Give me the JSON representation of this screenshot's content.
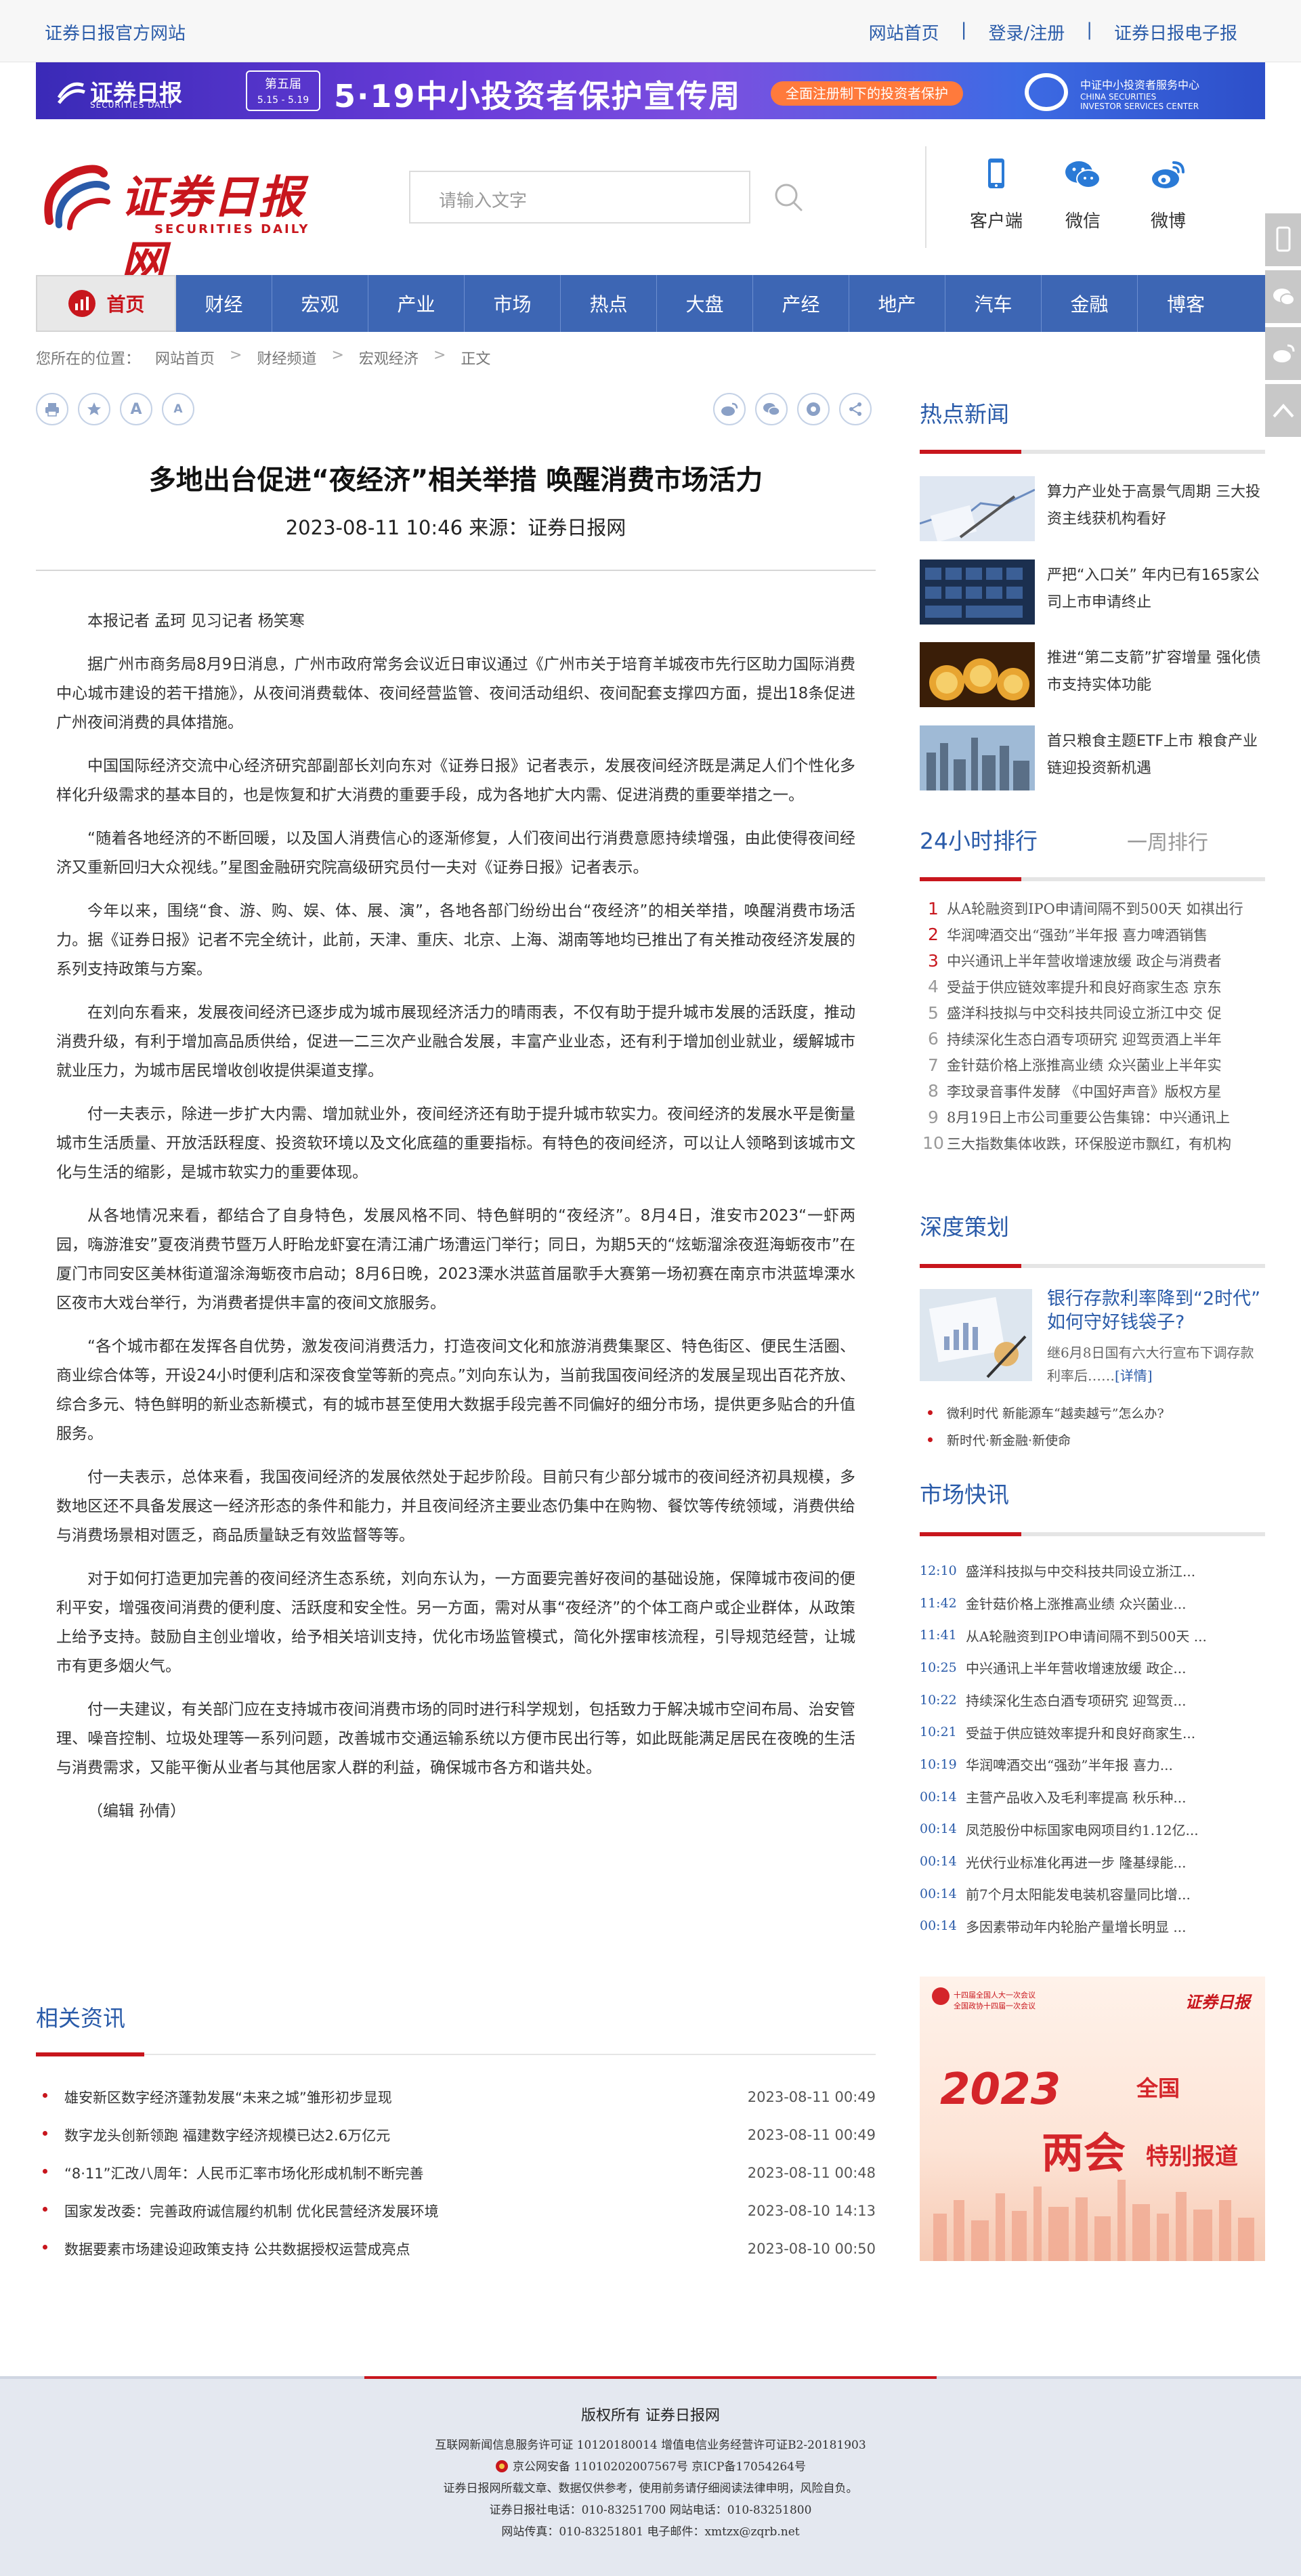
{
  "topbar": {
    "site_name": "证券日报官方网站",
    "links": [
      "网站首页",
      "登录/注册",
      "证券日报电子报"
    ],
    "sep": "|"
  },
  "banner": {
    "logo": "证券日报",
    "logo_sub": "SECURITIES DAILY",
    "badge_line1": "第五届",
    "badge_line2": "5.15 - 5.19",
    "title": "5·19中小投资者保护宣传周",
    "pill": "全面注册制下的投资者保护",
    "org_cn": "中证中小投资者服务中心",
    "org_en1": "CHINA SECURITIES",
    "org_en2": "INVESTOR SERVICES CENTER"
  },
  "header": {
    "logo_text": "证券日报网",
    "logo_en": "SECURITIES DAILY",
    "search_placeholder": "请输入文字",
    "icons": [
      {
        "label": "客户端",
        "icon": "phone-icon"
      },
      {
        "label": "微信",
        "icon": "wechat-icon"
      },
      {
        "label": "微博",
        "icon": "weibo-icon"
      }
    ]
  },
  "nav": {
    "home": "首页",
    "items": [
      "财经",
      "宏观",
      "产业",
      "市场",
      "热点",
      "大盘",
      "产经",
      "地产",
      "汽车",
      "金融",
      "博客"
    ]
  },
  "breadcrumb": {
    "label": "您所在的位置：",
    "items": [
      "网站首页",
      "财经频道",
      "宏观经济",
      "正文"
    ]
  },
  "article": {
    "tools_left": [
      "print-icon",
      "favorite-icon",
      "font-increase-icon",
      "font-decrease-icon"
    ],
    "font_big": "A",
    "font_small": "A",
    "tools_right": [
      "weibo-share-icon",
      "wechat-share-icon",
      "qzone-share-icon",
      "more-share-icon"
    ],
    "title": "多地出台促进“夜经济”相关举措 唤醒消费市场活力",
    "meta": "2023-08-11 10:46  来源：证券日报网",
    "paragraphs": [
      "本报记者 孟珂 见习记者 杨笑寒",
      "据广州市商务局8月9日消息，广州市政府常务会议近日审议通过《广州市关于培育羊城夜市先行区助力国际消费中心城市建设的若干措施》，从夜间消费载体、夜间经营监管、夜间活动组织、夜间配套支撑四方面，提出18条促进广州夜间消费的具体措施。",
      "中国国际经济交流中心经济研究部副部长刘向东对《证券日报》记者表示，发展夜间经济既是满足人们个性化多样化升级需求的基本目的，也是恢复和扩大消费的重要手段，成为各地扩大内需、促进消费的重要举措之一。",
      "“随着各地经济的不断回暖，以及国人消费信心的逐渐修复，人们夜间出行消费意愿持续增强，由此使得夜间经济又重新回归大众视线。”星图金融研究院高级研究员付一夫对《证券日报》记者表示。",
      "今年以来，围绕“食、游、购、娱、体、展、演”，各地各部门纷纷出台“夜经济”的相关举措，唤醒消费市场活力。据《证券日报》记者不完全统计，此前，天津、重庆、北京、上海、湖南等地均已推出了有关推动夜经济发展的系列支持政策与方案。",
      "在刘向东看来，发展夜间经济已逐步成为城市展现经济活力的晴雨表，不仅有助于提升城市发展的活跃度，推动消费升级，有利于增加高品质供给，促进一二三次产业融合发展，丰富产业业态，还有利于增加创业就业，缓解城市就业压力，为城市居民增收创收提供渠道支撑。",
      "付一夫表示，除进一步扩大内需、增加就业外，夜间经济还有助于提升城市软实力。夜间经济的发展水平是衡量城市生活质量、开放活跃程度、投资软环境以及文化底蕴的重要指标。有特色的夜间经济，可以让人领略到该城市文化与生活的缩影，是城市软实力的重要体现。",
      "从各地情况来看，都结合了自身特色，发展风格不同、特色鲜明的“夜经济”。8月4日，淮安市2023“一虾两园，嗨游淮安”夏夜消费节暨万人盱眙龙虾宴在清江浦广场漕运门举行；同日，为期5天的“炫蛎溜涂夜逛海蛎夜市”在厦门市同安区美林街道溜涂海蛎夜市启动；8月6日晚，2023溧水洪蓝首届歌手大赛第一场初赛在南京市洪蓝埠溧水区夜市大戏台举行，为消费者提供丰富的夜间文旅服务。",
      "“各个城市都在发挥各自优势，激发夜间消费活力，打造夜间文化和旅游消费集聚区、特色街区、便民生活圈、商业综合体等，开设24小时便利店和深夜食堂等新的亮点。”刘向东认为，当前我国夜间经济的发展呈现出百花齐放、综合多元、特色鲜明的新业态新模式，有的城市甚至使用大数据手段完善不同偏好的细分市场，提供更多贴合的升值服务。",
      "付一夫表示，总体来看，我国夜间经济的发展依然处于起步阶段。目前只有少部分城市的夜间经济初具规模，多数地区还不具备发展这一经济形态的条件和能力，并且夜间经济主要业态仍集中在购物、餐饮等传统领域，消费供给与消费场景相对匮乏，商品质量缺乏有效监督等等。",
      "对于如何打造更加完善的夜间经济生态系统，刘向东认为，一方面要完善好夜间的基础设施，保障城市夜间的便利平安，增强夜间消费的便利度、活跃度和安全性。另一方面，需对从事“夜经济”的个体工商户或企业群体，从政策上给予支持。鼓励自主创业增收，给予相关培训支持，优化市场监管模式，简化外摆审核流程，引导规范经营，让城市有更多烟火气。",
      "付一夫建议，有关部门应在支持城市夜间消费市场的同时进行科学规划，包括致力于解决城市空间布局、治安管理、噪音控制、垃圾处理等一系列问题，改善城市交通运输系统以方便市民出行等，如此既能满足居民在夜晚的生活与消费需求，又能平衡从业者与其他居家人群的利益，确保城市各方和谐共处。",
      "（编辑 孙倩）"
    ]
  },
  "related": {
    "title": "相关资讯",
    "items": [
      {
        "title": "雄安新区数字经济蓬勃发展“未来之城”雏形初步显现",
        "date": "2023-08-11 00:49"
      },
      {
        "title": "数字龙头创新领跑 福建数字经济规模已达2.6万亿元",
        "date": "2023-08-11 00:49"
      },
      {
        "title": "“8·11”汇改八周年：人民币汇率市场化形成机制不断完善",
        "date": "2023-08-11 00:48"
      },
      {
        "title": "国家发改委：完善政府诚信履约机制 优化民营经济发展环境",
        "date": "2023-08-10 14:13"
      },
      {
        "title": "数据要素市场建设迎政策支持 公共数据授权运营成亮点",
        "date": "2023-08-10 00:50"
      }
    ]
  },
  "sidebar": {
    "hot_title": "热点新闻",
    "hot": [
      {
        "title": "算力产业处于高景气周期 三大投资主线获机构看好"
      },
      {
        "title": "严把“入口关” 年内已有165家公司上市申请终止"
      },
      {
        "title": "推进“第二支箭”扩容增量 强化债市支持实体功能"
      },
      {
        "title": "首只粮食主题ETF上市 粮食产业链迎投资新机遇"
      }
    ],
    "rank_tab_active": "24小时排行",
    "rank_tab_other": "一周排行",
    "rank": [
      {
        "n": "1",
        "t": "从A轮融资到IPO申请间隔不到500天 如祺出行"
      },
      {
        "n": "2",
        "t": "华润啤酒交出“强劲”半年报 喜力啤酒销售"
      },
      {
        "n": "3",
        "t": "中兴通讯上半年营收增速放缓 政企与消费者"
      },
      {
        "n": "4",
        "t": "受益于供应链效率提升和良好商家生态 京东"
      },
      {
        "n": "5",
        "t": "盛洋科技拟与中交科技共同设立浙江中交 促"
      },
      {
        "n": "6",
        "t": "持续深化生态白酒专项研究 迎驾贡酒上半年"
      },
      {
        "n": "7",
        "t": "金针菇价格上涨推高业绩 众兴菌业上半年实"
      },
      {
        "n": "8",
        "t": "李玟录音事件发酵 《中国好声音》版权方星"
      },
      {
        "n": "9",
        "t": "8月19日上市公司重要公告集锦：中兴通讯上"
      },
      {
        "n": "10",
        "t": "三大指数集体收跌，环保股逆市飘红，有机构"
      }
    ],
    "deep_title": "深度策划",
    "deep_headline": "银行存款利率降到“2时代” 如何守好钱袋子?",
    "deep_desc": "继6月8日国有六大行宣布下调存款利率后……",
    "deep_more": "[详情]",
    "deep_links": [
      "微利时代 新能源车“越卖越亏”怎么办?",
      "新时代·新金融·新使命"
    ],
    "flash_title": "市场快讯",
    "flash": [
      {
        "time": "12:10",
        "text": "盛洋科技拟与中交科技共同设立浙江..."
      },
      {
        "time": "11:42",
        "text": "金针菇价格上涨推高业绩 众兴菌业..."
      },
      {
        "time": "11:41",
        "text": "从A轮融资到IPO申请间隔不到500天 ..."
      },
      {
        "time": "10:25",
        "text": "中兴通讯上半年营收增速放缓 政企..."
      },
      {
        "time": "10:22",
        "text": "持续深化生态白酒专项研究 迎驾贡..."
      },
      {
        "time": "10:21",
        "text": "受益于供应链效率提升和良好商家生..."
      },
      {
        "time": "10:19",
        "text": "华润啤酒交出“强劲”半年报 喜力..."
      },
      {
        "time": "00:14",
        "text": "主营产品收入及毛利率提高 秋乐种..."
      },
      {
        "time": "00:14",
        "text": "凤范股份中标国家电网项目约1.12亿..."
      },
      {
        "time": "00:14",
        "text": "光伏行业标准化再进一步 隆基绿能..."
      },
      {
        "time": "00:14",
        "text": "前7个月太阳能发电装机容量同比增..."
      },
      {
        "time": "00:14",
        "text": "多因素带动年内轮胎产量增长明显 ..."
      }
    ],
    "ad": {
      "left1": "十四届全国人大一次会议",
      "left2": "全国政协十四届一次会议",
      "brand": "证券日报",
      "year": "2023",
      "country": "全国",
      "big": "两会",
      "special": "特别报道"
    }
  },
  "footer": {
    "line1": "版权所有     证券日报网",
    "lines": [
      "互联网新闻信息服务许可证 10120180014      增值电信业务经营许可证B2-20181903",
      "京公网安备 11010202007567号      京ICP备17054264号",
      "证券日报网所载文章、数据仅供参考，使用前务请仔细阅读法律申明，风险自负。",
      "证券日报社电话：010-83251700      网站电话：010-83251800",
      "网站传真：010-83251801      电子邮件：xmtzx@zqrb.net"
    ]
  },
  "colors": {
    "brand_red": "#c8161d",
    "link_blue": "#2a5ba9",
    "nav_blue": "#3d66b4"
  }
}
